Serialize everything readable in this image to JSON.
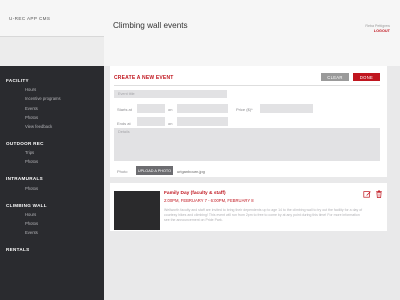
{
  "app": {
    "brand": "U-REC APP CMS"
  },
  "header": {
    "title": "Climbing wall events",
    "user_name": "Reba Pettigrew",
    "logout": "LOGOUT"
  },
  "sidebar": {
    "sections": [
      {
        "title": "FACILITY",
        "items": [
          "Hours",
          "Incentive programs",
          "Events",
          "Photos",
          "View feedback"
        ]
      },
      {
        "title": "OUTDOOR REC",
        "items": [
          "Trips",
          "Photos"
        ]
      },
      {
        "title": "INTRAMURALS",
        "items": [
          "Photos"
        ]
      },
      {
        "title": "CLIMBING WALL",
        "items": [
          "Hours",
          "Photos",
          "Events"
        ]
      },
      {
        "title": "RENTALS",
        "items": []
      }
    ]
  },
  "create_panel": {
    "title": "CREATE A NEW EVENT",
    "clear_label": "CLEAR",
    "done_label": "DONE",
    "event_title_placeholder": "Event title",
    "starts_label": "Starts at",
    "ends_label": "Ends at",
    "on_label": "on",
    "price_label": "Price ($)*",
    "details_placeholder": "Details",
    "photo_label": "Photo",
    "upload_label": "UPLOAD A PHOTO",
    "photo_filename": "uriganbourn.jpg"
  },
  "event": {
    "title": "Family Day (faculty & staff)",
    "date": "2:00PM, FEBRUARY 7 - 6:00PM, FEBRUARY 8",
    "description": "Wellworth faculty and staff are invited to bring their dependents up to age 14 to the climbing wall to try out the facility for a day of courtesy hikes and climbing! This event will run from 2pm to free to come by at any point during this time! For more information see the announcement on Pride Park."
  },
  "colors": {
    "accent": "#c0161f",
    "sidebar_dark": "#2a2b2f",
    "panel": "#ffffff",
    "background": "#e9e9ea"
  }
}
